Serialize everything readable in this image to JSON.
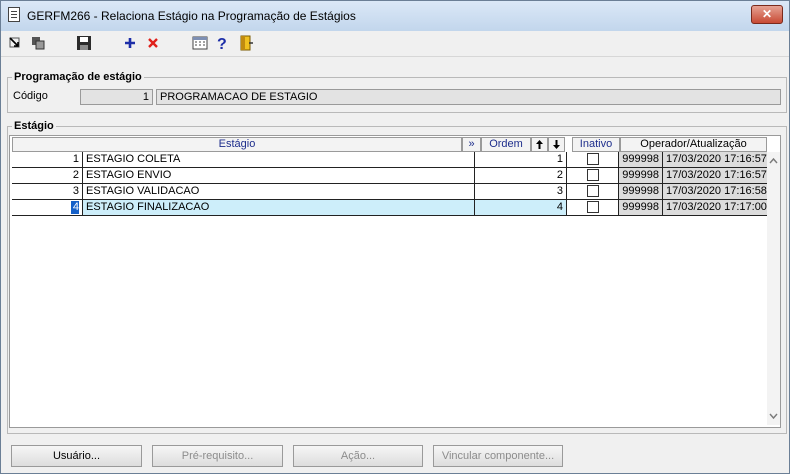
{
  "window": {
    "title": "GERFM266 - Relaciona Estágio na Programação de Estágios",
    "close_glyph": "✕"
  },
  "toolbar": {
    "icons": [
      "arrow-in-icon",
      "copy-icon",
      "save-icon",
      "add-icon",
      "delete-icon",
      "calculator-icon",
      "help-icon",
      "exit-door-icon"
    ]
  },
  "programacao": {
    "legend": "Programação de estágio",
    "codigo_label": "Código",
    "codigo_value": "1",
    "descricao": "PROGRAMACAO DE ESTAGIO"
  },
  "estagio_section": {
    "legend": "Estágio"
  },
  "grid": {
    "headers": {
      "estagio": "Estágio",
      "expand": "»",
      "ordem": "Ordem",
      "inativo": "Inativo",
      "operador": "Operador/Atualização"
    },
    "rows": [
      {
        "codigo": "1",
        "descricao": "ESTAGIO COLETA",
        "ordem": "1",
        "inativo": false,
        "operador": "999998",
        "atualizacao": "17/03/2020 17:16:57"
      },
      {
        "codigo": "2",
        "descricao": "ESTAGIO ENVIO",
        "ordem": "2",
        "inativo": false,
        "operador": "999998",
        "atualizacao": "17/03/2020 17:16:57"
      },
      {
        "codigo": "3",
        "descricao": "ESTAGIO VALIDACAO",
        "ordem": "3",
        "inativo": false,
        "operador": "999998",
        "atualizacao": "17/03/2020 17:16:58"
      },
      {
        "codigo": "4",
        "descricao": "ESTAGIO FINALIZACAO",
        "ordem": "4",
        "inativo": false,
        "operador": "999998",
        "atualizacao": "17/03/2020 17:17:00"
      }
    ]
  },
  "buttons": {
    "usuario": "Usuário...",
    "prerequisito": "Pré-requisito...",
    "acao": "Ação...",
    "vincular": "Vincular componente..."
  }
}
